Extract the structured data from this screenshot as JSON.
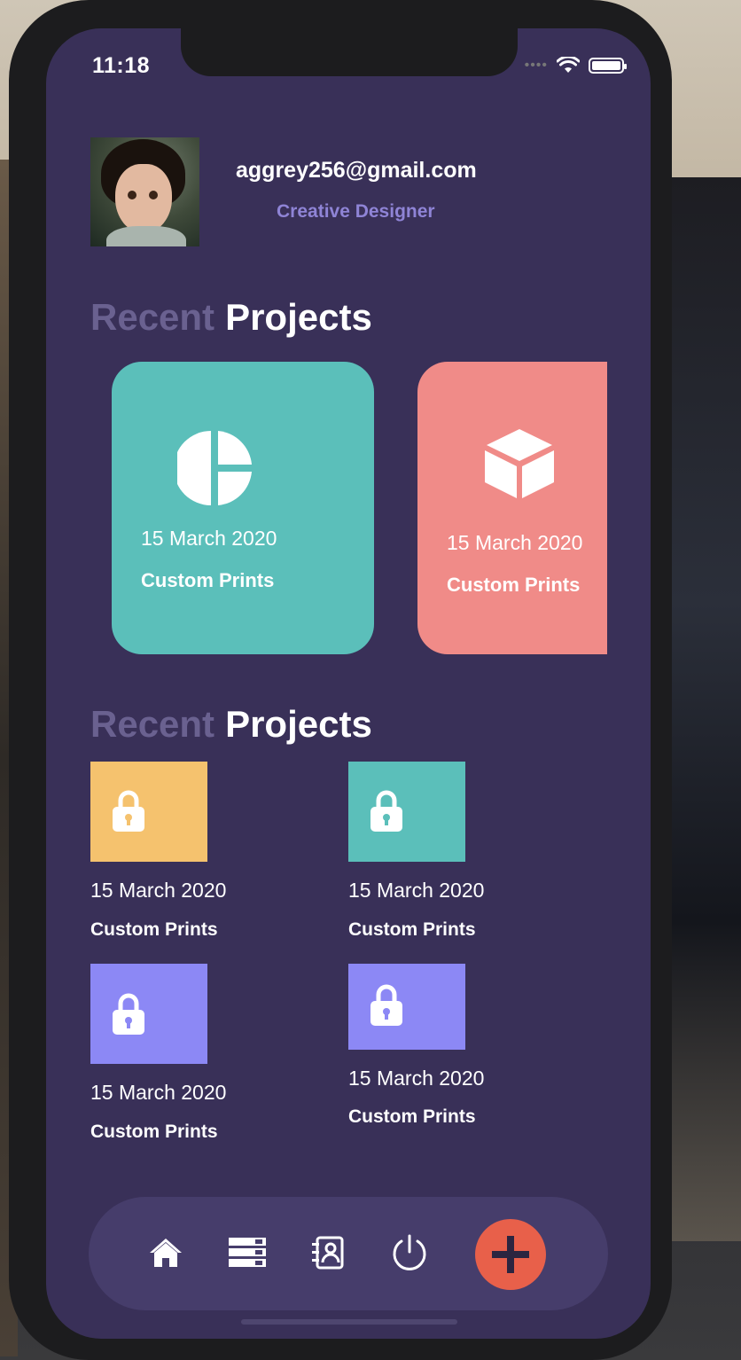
{
  "status": {
    "time": "11:18"
  },
  "profile": {
    "email": "aggrey256@gmail.com",
    "role": "Creative Designer"
  },
  "section1": {
    "muted": "Recent",
    "title": "Projects"
  },
  "cards": [
    {
      "date": "15 March 2020",
      "name": "Custom Prints",
      "color": "#5bbfba",
      "icon": "pie-chart-icon"
    },
    {
      "date": "15 March 2020",
      "name": "Custom Prints",
      "color": "#f08b88",
      "icon": "cube-icon"
    }
  ],
  "section2": {
    "muted": "Recent",
    "title": "Projects"
  },
  "tiles": [
    {
      "date": "15 March 2020",
      "name": "Custom Prints",
      "color": "#f5c26e",
      "icon": "lock-icon"
    },
    {
      "date": "15 March 2020",
      "name": "Custom Prints",
      "color": "#5bbfba",
      "icon": "lock-icon"
    },
    {
      "date": "15 March 2020",
      "name": "Custom Prints",
      "color": "#8c88f5",
      "icon": "lock-icon"
    },
    {
      "date": "15 March 2020",
      "name": "Custom Prints",
      "color": "#8c88f5",
      "icon": "lock-icon"
    }
  ],
  "nav": {
    "items": [
      "home-icon",
      "list-icon",
      "contacts-icon",
      "power-icon"
    ],
    "fab_icon": "plus-icon",
    "fab_color": "#e8604a"
  }
}
